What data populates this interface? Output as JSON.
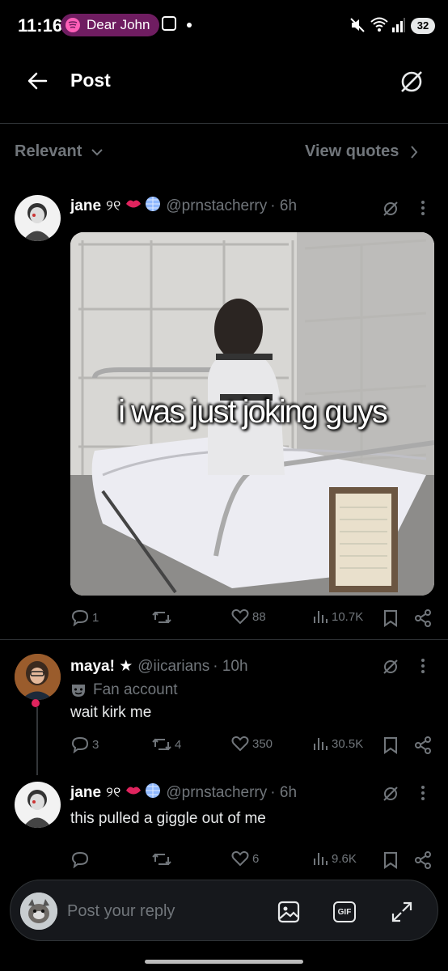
{
  "status_bar": {
    "time": "11:16",
    "media_label": "Dear John",
    "battery": "32"
  },
  "header": {
    "title": "Post"
  },
  "sort": {
    "label": "Relevant",
    "view_quotes": "View quotes"
  },
  "main_post": {
    "author": "jane",
    "handle": "@prnstacherry",
    "time": "· 6h",
    "image_caption": "i was just joking guys",
    "replies": "1",
    "reposts": "",
    "likes": "88",
    "views": "10.7K"
  },
  "replies": [
    {
      "author": "maya! ★",
      "handle": "@iicarians",
      "time": "· 10h",
      "label": "Fan account",
      "text": "wait kirk me",
      "replies": "3",
      "reposts": "4",
      "likes": "350",
      "views": "30.5K"
    },
    {
      "author": "jane",
      "handle": "@prnstacherry",
      "time": "· 6h",
      "text": "this pulled a giggle out of me",
      "replies": "",
      "reposts": "",
      "likes": "6",
      "views": "9.6K"
    }
  ],
  "composer": {
    "placeholder": "Post your reply",
    "gif_label": "GIF"
  },
  "colors": {
    "background": "#000000",
    "muted": "#71767b",
    "divider": "#2f3336",
    "spotify_pill": "#6f1d61"
  }
}
